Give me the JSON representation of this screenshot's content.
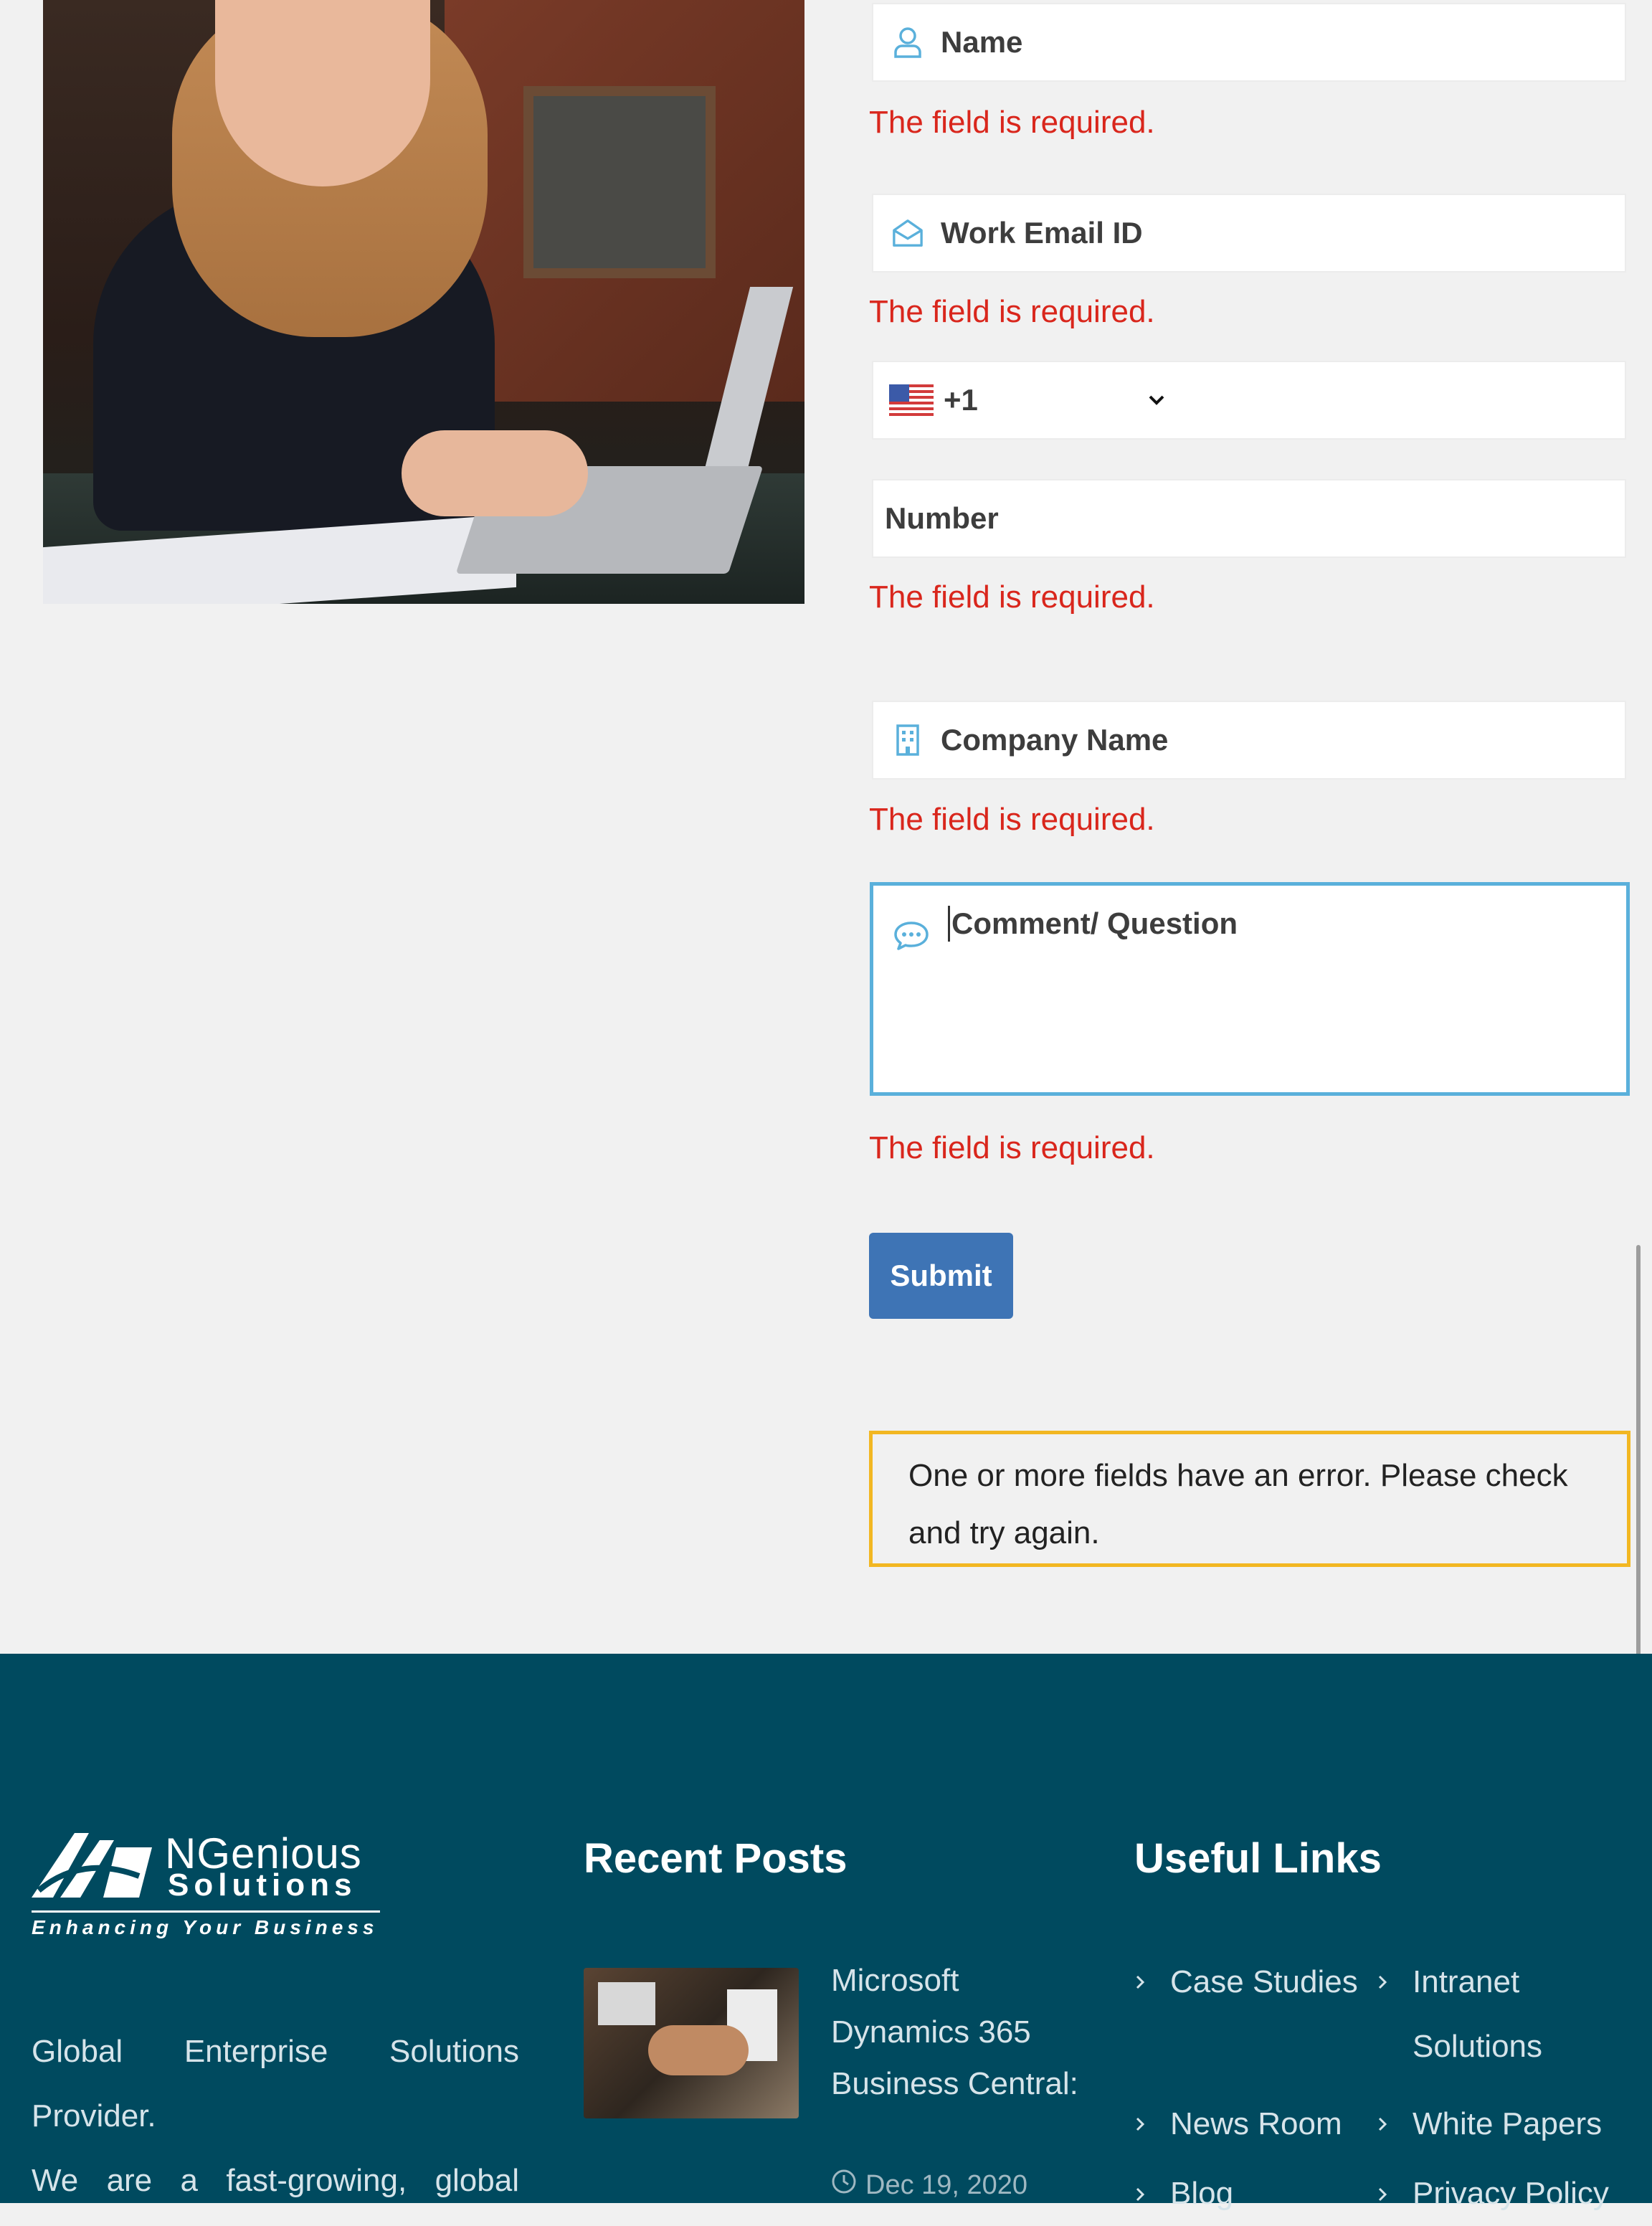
{
  "form": {
    "name_placeholder": "Name",
    "email_placeholder": "Work Email ID",
    "country_code": "+1",
    "number_placeholder": "Number",
    "company_placeholder": "Company Name",
    "comment_placeholder": "Comment/ Question",
    "error_text": "The field is required.",
    "submit_label": "Submit",
    "alert_text": "One or more fields have an error. Please check and try again."
  },
  "footer": {
    "logo": {
      "brand": "NGenious",
      "brand2": "Solutions",
      "tagline": "Enhancing Your Business"
    },
    "about_line1": [
      "Global",
      "Enterprise",
      "Solutions"
    ],
    "about_line2": "Provider.",
    "about_line3": [
      "We",
      "are",
      "a",
      "fast-growing,",
      "global"
    ],
    "recent_posts_title": "Recent Posts",
    "post_title": "Microsoft Dynamics 365 Business Central:",
    "post_date": "Dec 19, 2020",
    "useful_links_title": "Useful Links",
    "links": [
      "Case Studies",
      "Intranet Solutions",
      "News Room",
      "White Papers",
      "Blog",
      "Privacy Policy"
    ]
  },
  "colors": {
    "error": "#d9261c",
    "accent": "#5ab0db",
    "submit": "#3e74b5",
    "alert_border": "#f2b722",
    "footer_bg": "#004a5f"
  },
  "icons": [
    "user-icon",
    "envelope-open-icon",
    "us-flag-icon",
    "chevron-down-icon",
    "building-icon",
    "chat-bubble-icon",
    "chevron-right-icon",
    "clock-icon"
  ]
}
